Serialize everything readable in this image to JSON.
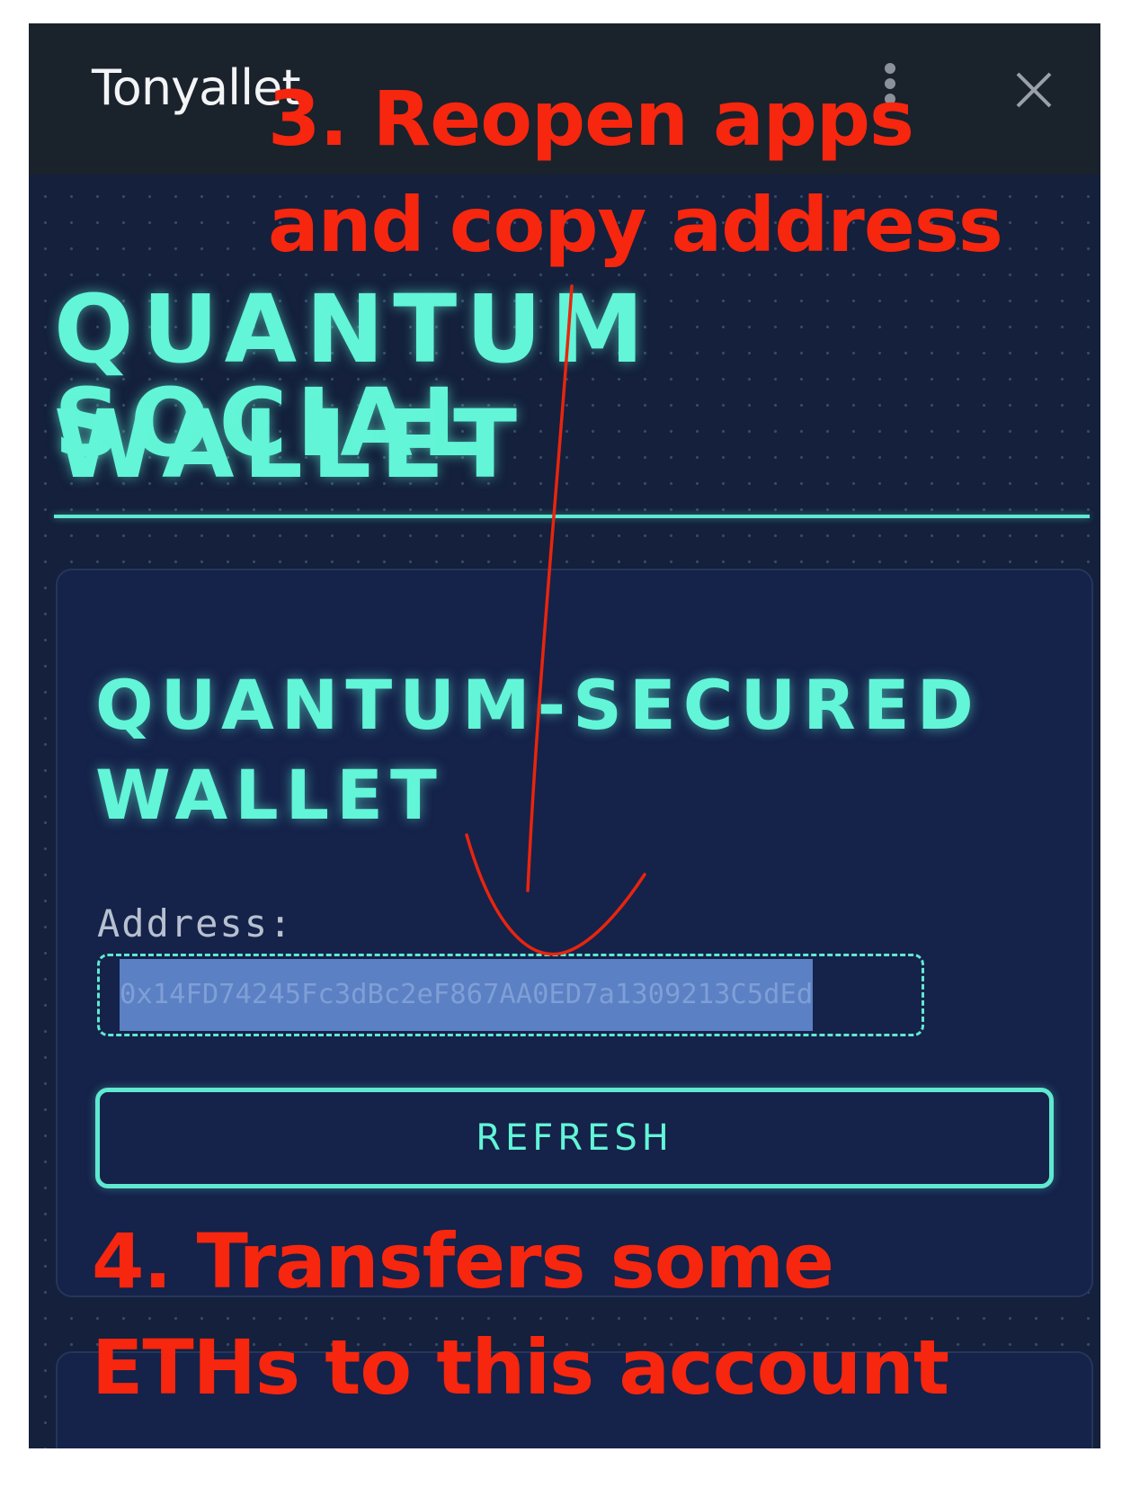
{
  "window": {
    "title": "Tonyallet"
  },
  "main": {
    "title_lines": [
      "QUANTUM SOCIAL",
      "WALLET"
    ]
  },
  "card": {
    "title_lines": [
      "QUANTUM-SECURED",
      "WALLET"
    ],
    "address_label": "Address:",
    "address_value": "0x14FD74245Fc3dBc2eF867AA0ED7a1309213C5dEd",
    "refresh_label": "REFRESH"
  },
  "annotations": {
    "step3_lines": [
      "3. Reopen apps",
      "and copy address"
    ],
    "step4_lines": [
      "4. Transfers some",
      "ETHs to this account"
    ]
  },
  "icons": {
    "menu": "more-vertical-icon",
    "close": "close-icon"
  },
  "colors": {
    "accent": "#62f5d7",
    "background": "#14203c",
    "titlebar": "#1a222c",
    "annotation": "#f7260e",
    "selection": "#5b80c4"
  }
}
